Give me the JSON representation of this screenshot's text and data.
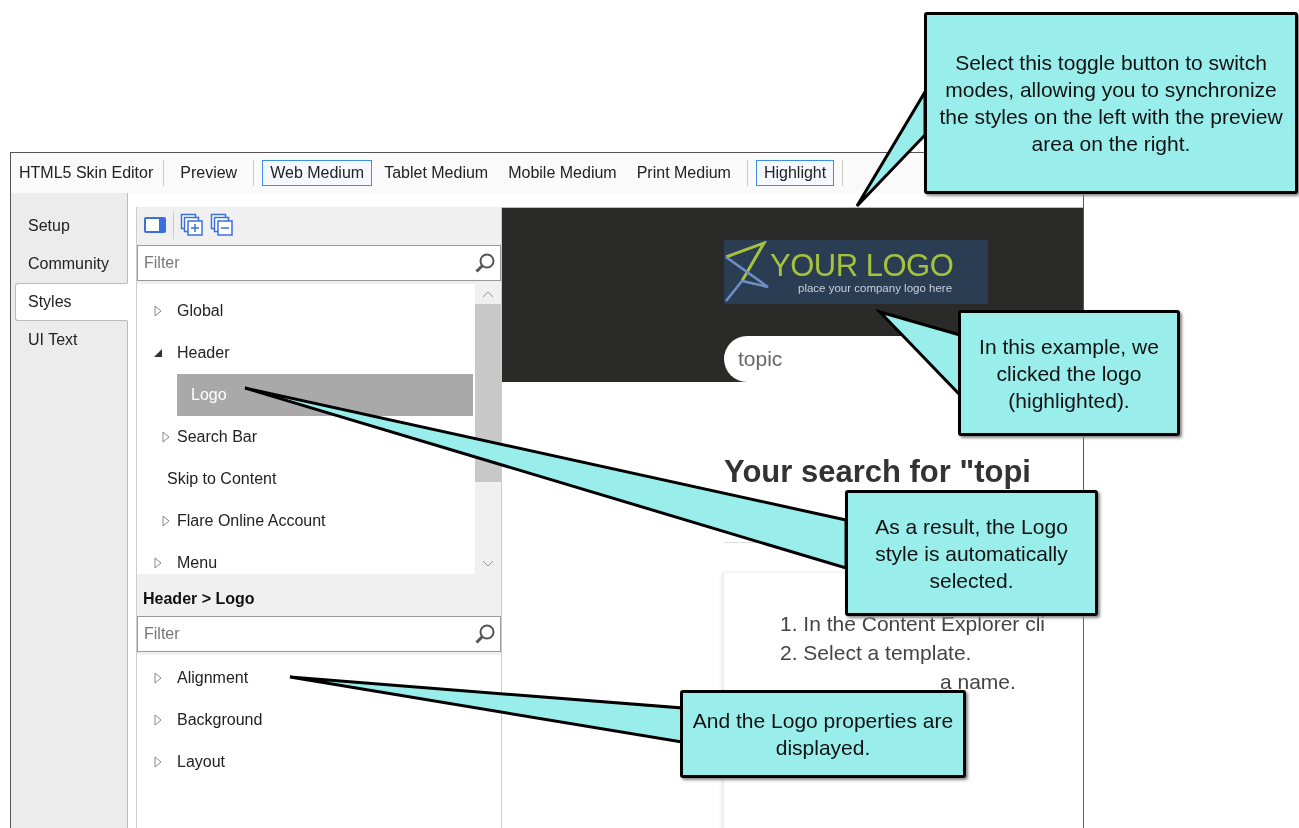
{
  "toolbar": {
    "title": "HTML5 Skin Editor",
    "items": [
      {
        "label": "Preview",
        "selected": false
      },
      {
        "label": "Web Medium",
        "selected": true
      },
      {
        "label": "Tablet Medium",
        "selected": false
      },
      {
        "label": "Mobile Medium",
        "selected": false
      },
      {
        "label": "Print Medium",
        "selected": false
      },
      {
        "label": "Highlight",
        "selected": true
      }
    ]
  },
  "side_tabs": [
    {
      "label": "Setup",
      "selected": false
    },
    {
      "label": "Community",
      "selected": false
    },
    {
      "label": "Styles",
      "selected": true
    },
    {
      "label": "UI Text",
      "selected": false
    }
  ],
  "styles_tree": {
    "filter": {
      "placeholder": "Filter"
    },
    "items": [
      {
        "label": "Global",
        "kind": "branch",
        "expanded": false,
        "selected": false
      },
      {
        "label": "Header",
        "kind": "branch",
        "expanded": true,
        "selected": false,
        "children": [
          {
            "label": "Logo",
            "kind": "leaf",
            "selected": true
          },
          {
            "label": "Search Bar",
            "kind": "branch",
            "expanded": false,
            "selected": false
          },
          {
            "label": "Skip to Content",
            "kind": "leaf",
            "selected": false
          },
          {
            "label": "Flare Online Account",
            "kind": "branch",
            "expanded": false,
            "selected": false
          }
        ]
      },
      {
        "label": "Menu",
        "kind": "branch",
        "expanded": false,
        "selected": false
      }
    ]
  },
  "properties": {
    "breadcrumb": "Header > Logo",
    "filter": {
      "placeholder": "Filter"
    },
    "items": [
      {
        "label": "Alignment",
        "expanded": false
      },
      {
        "label": "Background",
        "expanded": false
      },
      {
        "label": "Layout",
        "expanded": false
      }
    ]
  },
  "preview": {
    "logo": {
      "title": "YOUR LOGO",
      "tagline": "place your company logo here"
    },
    "search": {
      "value": "topic"
    },
    "heading": "Your search for \"topi",
    "list": [
      "1. In the Content Explorer cli",
      "2. Select a template.",
      "a name."
    ]
  },
  "callouts": [
    {
      "text": "Select this toggle button to switch modes, allowing you to synchronize the styles on the left with the preview area on the right."
    },
    {
      "text": "In this example, we clicked the logo (highlighted)."
    },
    {
      "text": "As a result, the Logo style is automatically selected."
    },
    {
      "text": "And the Logo properties are displayed."
    }
  ]
}
